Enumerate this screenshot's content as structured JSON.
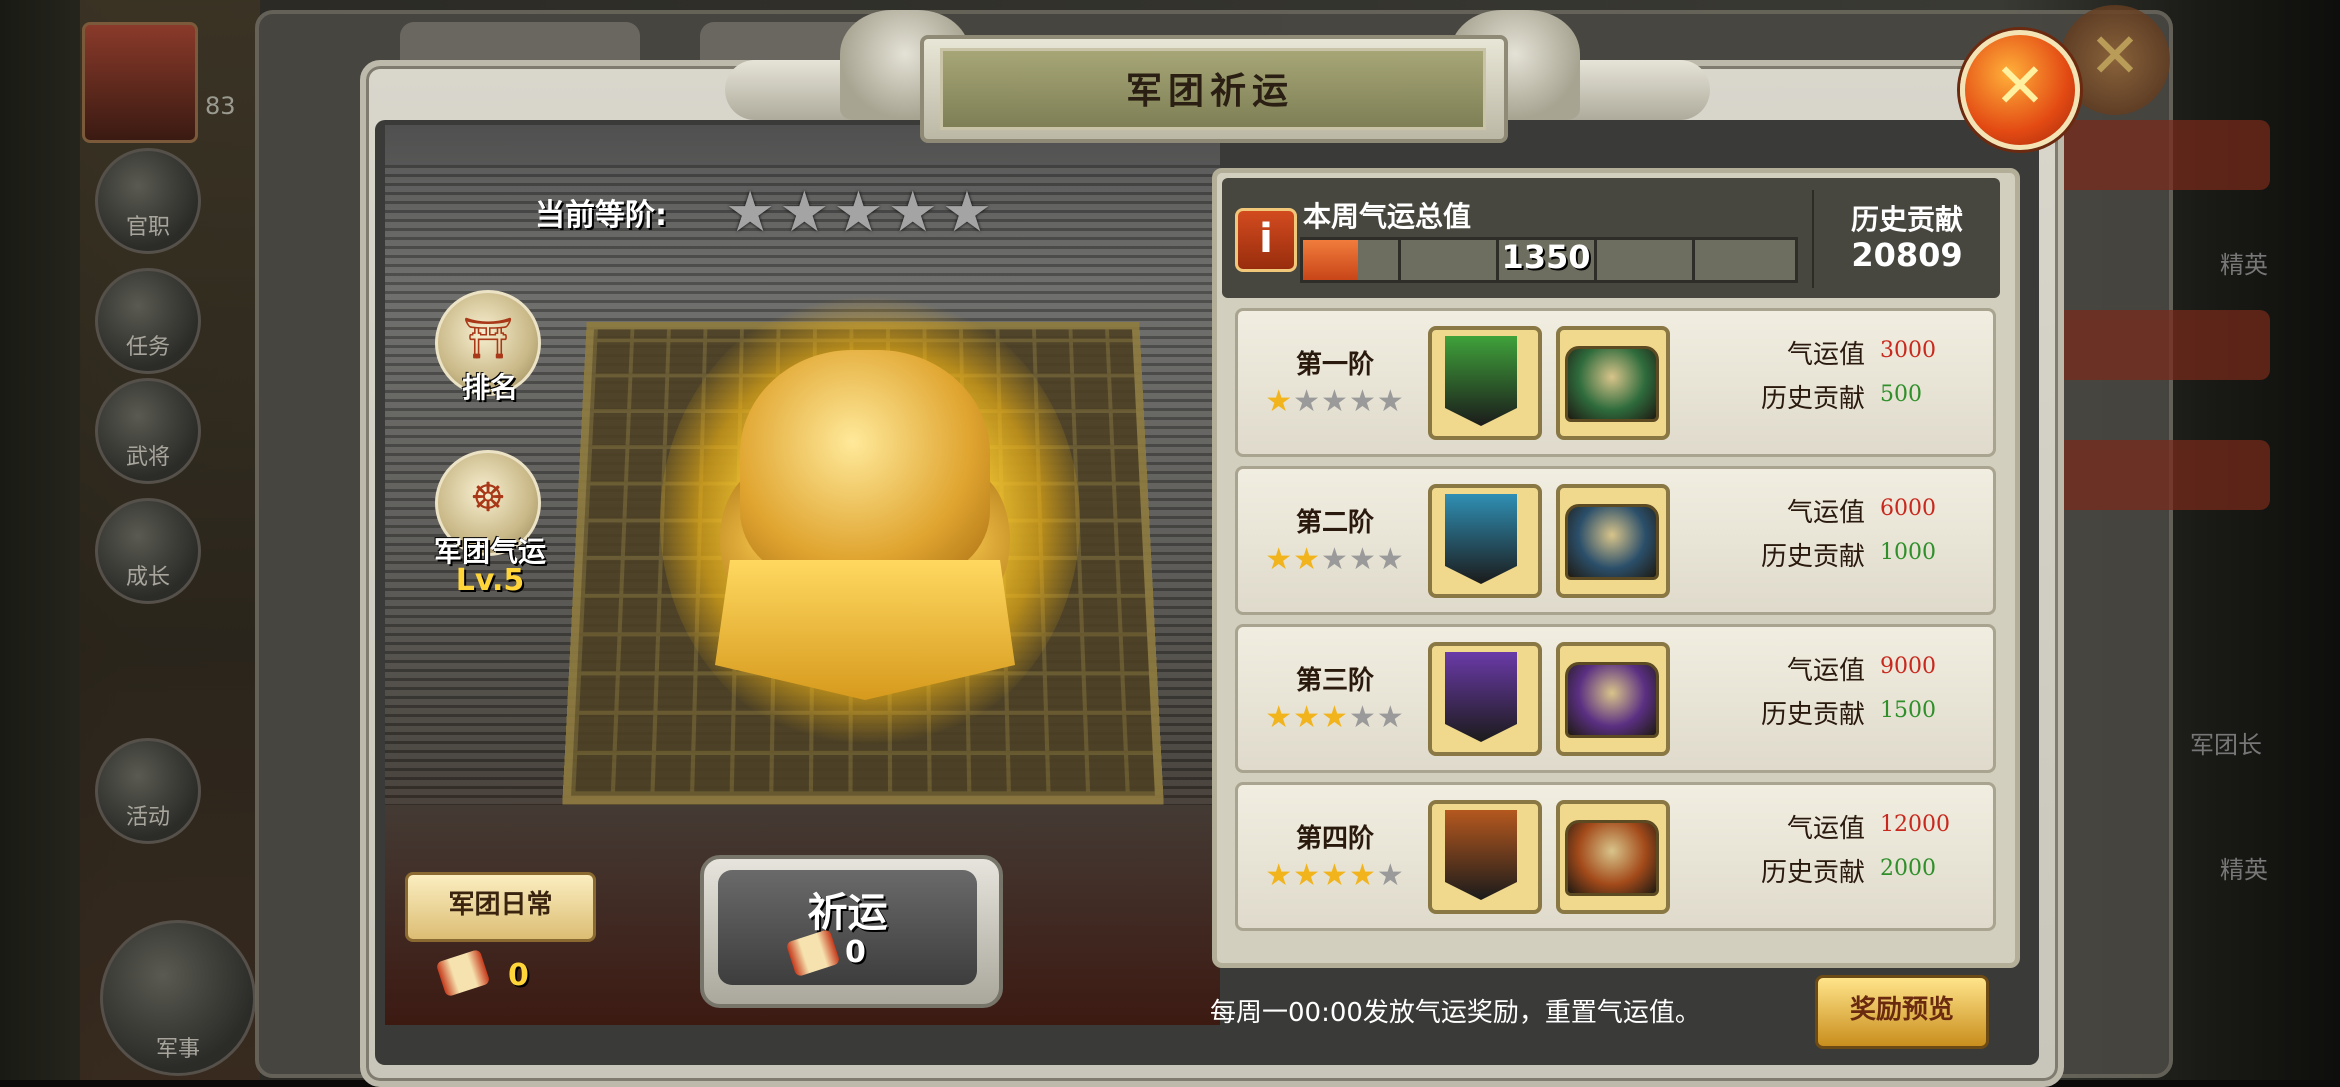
{
  "title": "军团祈运",
  "grade": {
    "label": "当前等阶:",
    "stars": "★★★★★",
    "filled": 0,
    "total": 5
  },
  "side": {
    "rank_label": "排名",
    "fortune_label": "军团气运",
    "level": "Lv.5"
  },
  "daily": {
    "label": "军团日常",
    "count": "0"
  },
  "pray": {
    "label": "祈运",
    "count": "0"
  },
  "header": {
    "week_label": "本周气运总值",
    "week_value": "1350",
    "week_progress": 0.1125,
    "history_label": "历史贡献",
    "history_value": "20809",
    "info_glyph": "i"
  },
  "tiers": [
    {
      "name": "第一阶",
      "stars": "★★★★★",
      "filled": 1,
      "fortune_label": "气运值",
      "fortune": "3000",
      "contrib_label": "历史贡献",
      "contrib": "500",
      "color": "#3fa23a",
      "chest": "#2e6b3c"
    },
    {
      "name": "第二阶",
      "stars": "★★★★★",
      "filled": 2,
      "fortune_label": "气运值",
      "fortune": "6000",
      "contrib_label": "历史贡献",
      "contrib": "1000",
      "color": "#2f8fb4",
      "chest": "#2b4f6a"
    },
    {
      "name": "第三阶",
      "stars": "★★★★★",
      "filled": 3,
      "fortune_label": "气运值",
      "fortune": "9000",
      "contrib_label": "历史贡献",
      "contrib": "1500",
      "color": "#6a3aa8",
      "chest": "#5a2f82"
    },
    {
      "name": "第四阶",
      "stars": "★★★★★",
      "filled": 4,
      "fortune_label": "气运值",
      "fortune": "12000",
      "contrib_label": "历史贡献",
      "contrib": "2000",
      "color": "#b5581e",
      "chest": "#a34a1a"
    }
  ],
  "footer": "每周一00:00发放气运奖励，重置气运值。",
  "preview_label": "奖励预览",
  "close_glyph": "✕",
  "colors": {
    "fortune_red": "#c8281e",
    "contrib_green": "#2f8f2a",
    "star_gold": "#f2b41c",
    "star_gray": "#9a9a9a"
  },
  "background": {
    "left_items": [
      "官职",
      "任务",
      "武将",
      "成长",
      "活动",
      "军事"
    ],
    "level_text": "83",
    "right_texts": [
      "精英",
      "军团长",
      "精英"
    ]
  }
}
